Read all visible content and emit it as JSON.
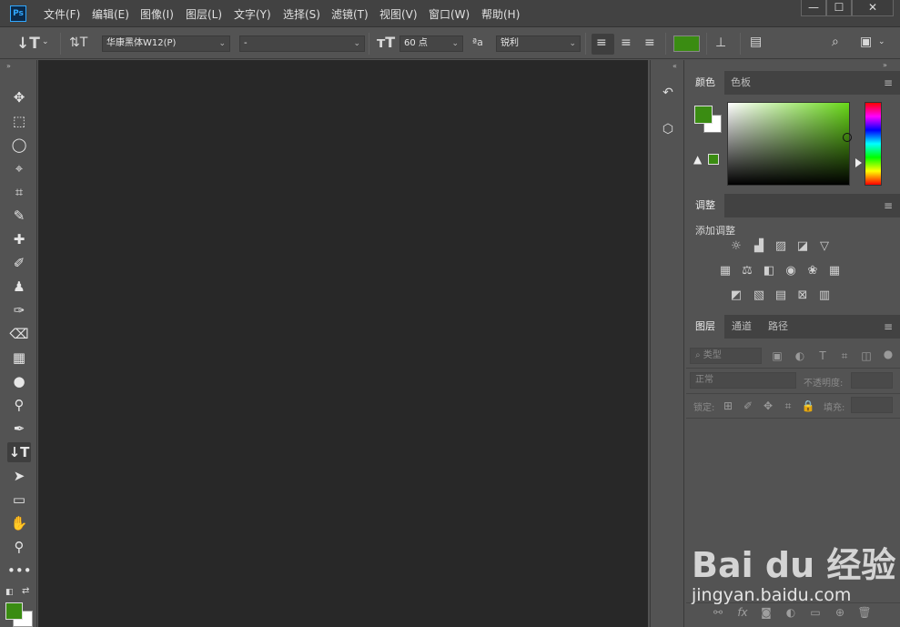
{
  "app": {
    "logo_text": "Ps"
  },
  "menu": [
    "文件(F)",
    "编辑(E)",
    "图像(I)",
    "图层(L)",
    "文字(Y)",
    "选择(S)",
    "滤镜(T)",
    "视图(V)",
    "窗口(W)",
    "帮助(H)"
  ],
  "window_controls": {
    "minimize": "—",
    "maximize": "☐",
    "close": "✕"
  },
  "options": {
    "font_family": "华康黑体W12(P)",
    "font_style": "-",
    "font_size": "60 点",
    "antialias_label": "ªa",
    "antialias": "锐利",
    "text_color": "#3a8c12"
  },
  "colors": {
    "foreground": "#3a8c12",
    "background": "#ffffff"
  },
  "color_panel": {
    "tabs": [
      "颜色",
      "色板"
    ]
  },
  "adjustments_panel": {
    "tab": "调整",
    "title": "添加调整"
  },
  "layers_panel": {
    "tabs": [
      "图层",
      "通道",
      "路径"
    ],
    "filter_placeholder": "类型",
    "blend_mode": "正常",
    "opacity_label": "不透明度:",
    "lock_label": "锁定:",
    "fill_label": "填充:"
  },
  "watermark": {
    "logo": "Bai du 经验",
    "url": "jingyan.baidu.com"
  }
}
